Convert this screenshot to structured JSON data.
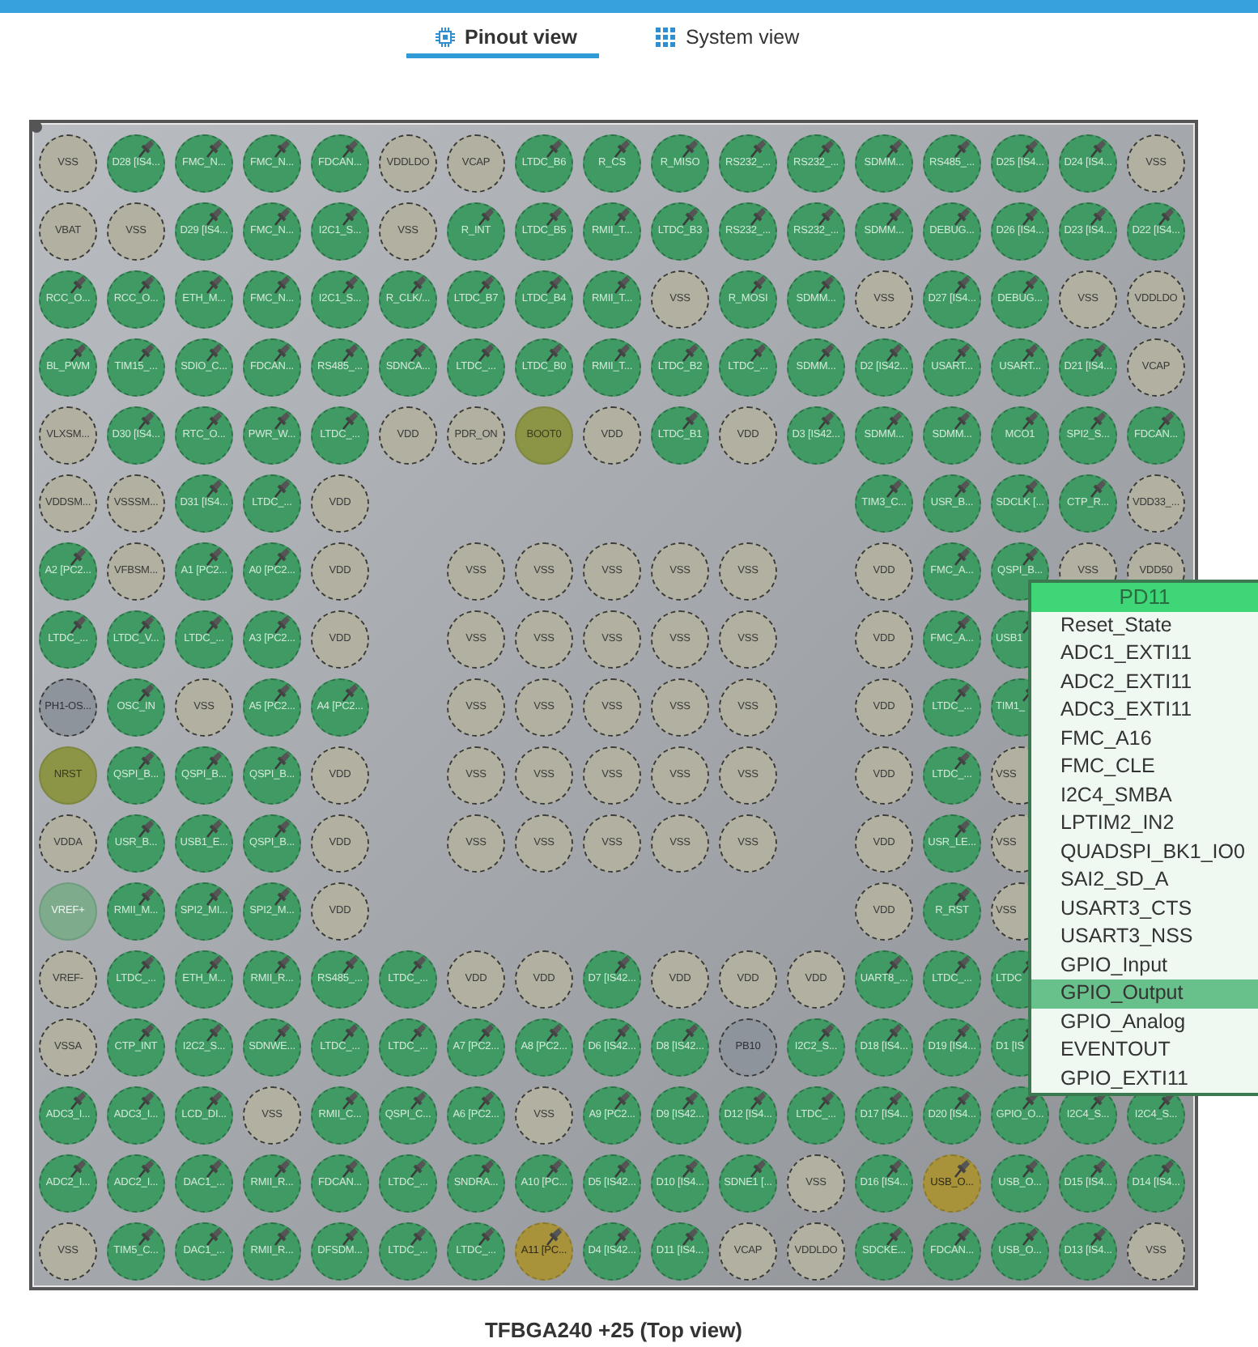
{
  "tabs": [
    {
      "label": "Pinout view",
      "selected": true,
      "kind": "pinout"
    },
    {
      "label": "System view",
      "selected": false,
      "kind": "system"
    }
  ],
  "package": {
    "caption": "TFBGA240 +25 (Top view)",
    "rows": [
      [
        {
          "label": "VSS",
          "kind": "power"
        },
        {
          "label": "D28 [IS4...",
          "kind": "signal"
        },
        {
          "label": "FMC_N...",
          "kind": "signal"
        },
        {
          "label": "FMC_N...",
          "kind": "signal"
        },
        {
          "label": "FDCAN...",
          "kind": "signal"
        },
        {
          "label": "VDDLDO",
          "kind": "power"
        },
        {
          "label": "VCAP",
          "kind": "power"
        },
        {
          "label": "LTDC_B6",
          "kind": "signal"
        },
        {
          "label": "R_CS",
          "kind": "signal"
        },
        {
          "label": "R_MISO",
          "kind": "signal"
        },
        {
          "label": "RS232_...",
          "kind": "signal"
        },
        {
          "label": "RS232_...",
          "kind": "signal"
        },
        {
          "label": "SDMM...",
          "kind": "signal"
        },
        {
          "label": "RS485_...",
          "kind": "signal"
        },
        {
          "label": "D25 [IS4...",
          "kind": "signal"
        },
        {
          "label": "D24 [IS4...",
          "kind": "signal"
        },
        {
          "label": "VSS",
          "kind": "power"
        }
      ],
      [
        {
          "label": "VBAT",
          "kind": "power"
        },
        {
          "label": "VSS",
          "kind": "power"
        },
        {
          "label": "D29 [IS4...",
          "kind": "signal"
        },
        {
          "label": "FMC_N...",
          "kind": "signal"
        },
        {
          "label": "I2C1_S...",
          "kind": "signal"
        },
        {
          "label": "VSS",
          "kind": "power"
        },
        {
          "label": "R_INT",
          "kind": "signal"
        },
        {
          "label": "LTDC_B5",
          "kind": "signal"
        },
        {
          "label": "RMII_T...",
          "kind": "signal"
        },
        {
          "label": "LTDC_B3",
          "kind": "signal"
        },
        {
          "label": "RS232_...",
          "kind": "signal"
        },
        {
          "label": "RS232_...",
          "kind": "signal"
        },
        {
          "label": "SDMM...",
          "kind": "signal"
        },
        {
          "label": "DEBUG...",
          "kind": "signal"
        },
        {
          "label": "D26 [IS4...",
          "kind": "signal"
        },
        {
          "label": "D23 [IS4...",
          "kind": "signal"
        },
        {
          "label": "D22 [IS4...",
          "kind": "signal"
        }
      ],
      [
        {
          "label": "RCC_O...",
          "kind": "signal"
        },
        {
          "label": "RCC_O...",
          "kind": "signal"
        },
        {
          "label": "ETH_M...",
          "kind": "signal"
        },
        {
          "label": "FMC_N...",
          "kind": "signal"
        },
        {
          "label": "I2C1_S...",
          "kind": "signal"
        },
        {
          "label": "R_CLK/...",
          "kind": "signal"
        },
        {
          "label": "LTDC_B7",
          "kind": "signal"
        },
        {
          "label": "LTDC_B4",
          "kind": "signal"
        },
        {
          "label": "RMII_T...",
          "kind": "signal"
        },
        {
          "label": "VSS",
          "kind": "power"
        },
        {
          "label": "R_MOSI",
          "kind": "signal"
        },
        {
          "label": "SDMM...",
          "kind": "signal"
        },
        {
          "label": "VSS",
          "kind": "power"
        },
        {
          "label": "D27 [IS4...",
          "kind": "signal"
        },
        {
          "label": "DEBUG...",
          "kind": "signal"
        },
        {
          "label": "VSS",
          "kind": "power"
        },
        {
          "label": "VDDLDO",
          "kind": "power"
        }
      ],
      [
        {
          "label": "BL_PWM",
          "kind": "signal"
        },
        {
          "label": "TIM15_...",
          "kind": "signal"
        },
        {
          "label": "SDIO_C...",
          "kind": "signal"
        },
        {
          "label": "FDCAN...",
          "kind": "signal"
        },
        {
          "label": "RS485_...",
          "kind": "signal"
        },
        {
          "label": "SDNCA...",
          "kind": "signal"
        },
        {
          "label": "LTDC_...",
          "kind": "signal"
        },
        {
          "label": "LTDC_B0",
          "kind": "signal"
        },
        {
          "label": "RMII_T...",
          "kind": "signal"
        },
        {
          "label": "LTDC_B2",
          "kind": "signal"
        },
        {
          "label": "LTDC_...",
          "kind": "signal"
        },
        {
          "label": "SDMM...",
          "kind": "signal"
        },
        {
          "label": "D2 [IS42...",
          "kind": "signal"
        },
        {
          "label": "USART...",
          "kind": "signal"
        },
        {
          "label": "USART...",
          "kind": "signal"
        },
        {
          "label": "D21 [IS4...",
          "kind": "signal"
        },
        {
          "label": "VCAP",
          "kind": "power"
        }
      ],
      [
        {
          "label": "VLXSM...",
          "kind": "power"
        },
        {
          "label": "D30 [IS4...",
          "kind": "signal"
        },
        {
          "label": "RTC_O...",
          "kind": "signal"
        },
        {
          "label": "PWR_W...",
          "kind": "signal"
        },
        {
          "label": "LTDC_...",
          "kind": "signal"
        },
        {
          "label": "VDD",
          "kind": "power"
        },
        {
          "label": "PDR_ON",
          "kind": "power"
        },
        {
          "label": "BOOT0",
          "kind": "reset"
        },
        {
          "label": "VDD",
          "kind": "power"
        },
        {
          "label": "LTDC_B1",
          "kind": "signal"
        },
        {
          "label": "VDD",
          "kind": "power"
        },
        {
          "label": "D3 [IS42...",
          "kind": "signal"
        },
        {
          "label": "SDMM...",
          "kind": "signal"
        },
        {
          "label": "SDMM...",
          "kind": "signal"
        },
        {
          "label": "MCO1",
          "kind": "signal"
        },
        {
          "label": "SPI2_S...",
          "kind": "signal"
        },
        {
          "label": "FDCAN...",
          "kind": "signal"
        }
      ],
      [
        {
          "label": "VDDSM...",
          "kind": "power"
        },
        {
          "label": "VSSSM...",
          "kind": "power"
        },
        {
          "label": "D31 [IS4...",
          "kind": "signal"
        },
        {
          "label": "LTDC_...",
          "kind": "signal"
        },
        {
          "label": "VDD",
          "kind": "power"
        },
        null,
        null,
        null,
        null,
        null,
        null,
        null,
        {
          "label": "TIM3_C...",
          "kind": "signal"
        },
        {
          "label": "USR_B...",
          "kind": "signal"
        },
        {
          "label": "SDCLK [...",
          "kind": "signal"
        },
        {
          "label": "CTP_R...",
          "kind": "signal"
        },
        {
          "label": "VDD33_...",
          "kind": "power"
        }
      ],
      [
        {
          "label": "A2 [PC2...",
          "kind": "signal"
        },
        {
          "label": "VFBSM...",
          "kind": "power"
        },
        {
          "label": "A1 [PC2...",
          "kind": "signal"
        },
        {
          "label": "A0 [PC2...",
          "kind": "signal"
        },
        {
          "label": "VDD",
          "kind": "power"
        },
        null,
        {
          "label": "VSS",
          "kind": "power"
        },
        {
          "label": "VSS",
          "kind": "power"
        },
        {
          "label": "VSS",
          "kind": "power"
        },
        {
          "label": "VSS",
          "kind": "power"
        },
        {
          "label": "VSS",
          "kind": "power"
        },
        null,
        {
          "label": "VDD",
          "kind": "power"
        },
        {
          "label": "FMC_A...",
          "kind": "signal"
        },
        {
          "label": "QSPI_B...",
          "kind": "signal"
        },
        {
          "label": "VSS",
          "kind": "power"
        },
        {
          "label": "VDD50",
          "kind": "power"
        }
      ],
      [
        {
          "label": "LTDC_...",
          "kind": "signal"
        },
        {
          "label": "LTDC_V...",
          "kind": "signal"
        },
        {
          "label": "LTDC_...",
          "kind": "signal"
        },
        {
          "label": "A3 [PC2...",
          "kind": "signal"
        },
        {
          "label": "VDD",
          "kind": "power"
        },
        null,
        {
          "label": "VSS",
          "kind": "power"
        },
        {
          "label": "VSS",
          "kind": "power"
        },
        {
          "label": "VSS",
          "kind": "power"
        },
        {
          "label": "VSS",
          "kind": "power"
        },
        {
          "label": "VSS",
          "kind": "power"
        },
        null,
        {
          "label": "VDD",
          "kind": "power"
        },
        {
          "label": "FMC_A...",
          "kind": "signal"
        },
        {
          "label": "USB1",
          "kind": "signal-cut"
        },
        null,
        null
      ],
      [
        {
          "label": "PH1-OS...",
          "kind": "osc"
        },
        {
          "label": "OSC_IN",
          "kind": "signal"
        },
        {
          "label": "VSS",
          "kind": "power"
        },
        {
          "label": "A5 [PC2...",
          "kind": "signal"
        },
        {
          "label": "A4 [PC2...",
          "kind": "signal"
        },
        null,
        {
          "label": "VSS",
          "kind": "power"
        },
        {
          "label": "VSS",
          "kind": "power"
        },
        {
          "label": "VSS",
          "kind": "power"
        },
        {
          "label": "VSS",
          "kind": "power"
        },
        {
          "label": "VSS",
          "kind": "power"
        },
        null,
        {
          "label": "VDD",
          "kind": "power"
        },
        {
          "label": "LTDC_...",
          "kind": "signal"
        },
        {
          "label": "TIM1_",
          "kind": "signal-cut"
        },
        null,
        null
      ],
      [
        {
          "label": "NRST",
          "kind": "reset"
        },
        {
          "label": "QSPI_B...",
          "kind": "signal"
        },
        {
          "label": "QSPI_B...",
          "kind": "signal"
        },
        {
          "label": "QSPI_B...",
          "kind": "signal"
        },
        {
          "label": "VDD",
          "kind": "power"
        },
        null,
        {
          "label": "VSS",
          "kind": "power"
        },
        {
          "label": "VSS",
          "kind": "power"
        },
        {
          "label": "VSS",
          "kind": "power"
        },
        {
          "label": "VSS",
          "kind": "power"
        },
        {
          "label": "VSS",
          "kind": "power"
        },
        null,
        {
          "label": "VDD",
          "kind": "power"
        },
        {
          "label": "LTDC_...",
          "kind": "signal"
        },
        {
          "label": "VSS",
          "kind": "power-cut"
        },
        null,
        null
      ],
      [
        {
          "label": "VDDA",
          "kind": "power"
        },
        {
          "label": "USR_B...",
          "kind": "signal"
        },
        {
          "label": "USB1_E...",
          "kind": "signal"
        },
        {
          "label": "QSPI_B...",
          "kind": "signal"
        },
        {
          "label": "VDD",
          "kind": "power"
        },
        null,
        {
          "label": "VSS",
          "kind": "power"
        },
        {
          "label": "VSS",
          "kind": "power"
        },
        {
          "label": "VSS",
          "kind": "power"
        },
        {
          "label": "VSS",
          "kind": "power"
        },
        {
          "label": "VSS",
          "kind": "power"
        },
        null,
        {
          "label": "VDD",
          "kind": "power"
        },
        {
          "label": "USR_LE...",
          "kind": "signal"
        },
        {
          "label": "VSS",
          "kind": "power-cut"
        },
        null,
        null
      ],
      [
        {
          "label": "VREF+",
          "kind": "analog"
        },
        {
          "label": "RMII_M...",
          "kind": "signal"
        },
        {
          "label": "SPI2_MI...",
          "kind": "signal"
        },
        {
          "label": "SPI2_M...",
          "kind": "signal"
        },
        {
          "label": "VDD",
          "kind": "power"
        },
        null,
        null,
        null,
        null,
        null,
        null,
        null,
        {
          "label": "VDD",
          "kind": "power"
        },
        {
          "label": "R_RST",
          "kind": "signal"
        },
        {
          "label": "VSS",
          "kind": "power-cut"
        },
        null,
        null
      ],
      [
        {
          "label": "VREF-",
          "kind": "power"
        },
        {
          "label": "LTDC_...",
          "kind": "signal"
        },
        {
          "label": "ETH_M...",
          "kind": "signal"
        },
        {
          "label": "RMII_R...",
          "kind": "signal"
        },
        {
          "label": "RS485_...",
          "kind": "signal"
        },
        {
          "label": "LTDC_...",
          "kind": "signal"
        },
        {
          "label": "VDD",
          "kind": "power"
        },
        {
          "label": "VDD",
          "kind": "power"
        },
        {
          "label": "D7 [IS42...",
          "kind": "signal"
        },
        {
          "label": "VDD",
          "kind": "power"
        },
        {
          "label": "VDD",
          "kind": "power"
        },
        {
          "label": "VDD",
          "kind": "power"
        },
        {
          "label": "UART8_...",
          "kind": "signal"
        },
        {
          "label": "LTDC_...",
          "kind": "signal"
        },
        {
          "label": "LTDC",
          "kind": "signal-cut"
        },
        null,
        null
      ],
      [
        {
          "label": "VSSA",
          "kind": "power"
        },
        {
          "label": "CTP_INT",
          "kind": "signal"
        },
        {
          "label": "I2C2_S...",
          "kind": "signal"
        },
        {
          "label": "SDNWE...",
          "kind": "signal"
        },
        {
          "label": "LTDC_...",
          "kind": "signal"
        },
        {
          "label": "LTDC_...",
          "kind": "signal"
        },
        {
          "label": "A7 [PC2...",
          "kind": "signal"
        },
        {
          "label": "A8 [PC2...",
          "kind": "signal"
        },
        {
          "label": "D6 [IS42...",
          "kind": "signal"
        },
        {
          "label": "D8 [IS42...",
          "kind": "signal"
        },
        {
          "label": "PB10",
          "kind": "osc"
        },
        {
          "label": "I2C2_S...",
          "kind": "signal"
        },
        {
          "label": "D18 [IS4...",
          "kind": "signal"
        },
        {
          "label": "D19 [IS4...",
          "kind": "signal"
        },
        {
          "label": "D1 [IS",
          "kind": "signal-cut"
        },
        null,
        null
      ],
      [
        {
          "label": "ADC3_I...",
          "kind": "signal"
        },
        {
          "label": "ADC3_I...",
          "kind": "signal"
        },
        {
          "label": "LCD_DI...",
          "kind": "signal"
        },
        {
          "label": "VSS",
          "kind": "power"
        },
        {
          "label": "RMII_C...",
          "kind": "signal"
        },
        {
          "label": "QSPI_C...",
          "kind": "signal"
        },
        {
          "label": "A6 [PC2...",
          "kind": "signal"
        },
        {
          "label": "VSS",
          "kind": "power"
        },
        {
          "label": "A9 [PC2...",
          "kind": "signal"
        },
        {
          "label": "D9 [IS42...",
          "kind": "signal"
        },
        {
          "label": "D12 [IS4...",
          "kind": "signal"
        },
        {
          "label": "LTDC_...",
          "kind": "signal"
        },
        {
          "label": "D17 [IS4...",
          "kind": "signal"
        },
        {
          "label": "D20 [IS4...",
          "kind": "signal"
        },
        {
          "label": "GPIO_O...",
          "kind": "signal"
        },
        {
          "label": "I2C4_S...",
          "kind": "signal"
        },
        {
          "label": "I2C4_S...",
          "kind": "signal"
        }
      ],
      [
        {
          "label": "ADC2_I...",
          "kind": "signal"
        },
        {
          "label": "ADC2_I...",
          "kind": "signal"
        },
        {
          "label": "DAC1_...",
          "kind": "signal"
        },
        {
          "label": "RMII_R...",
          "kind": "signal"
        },
        {
          "label": "FDCAN...",
          "kind": "signal"
        },
        {
          "label": "LTDC_...",
          "kind": "signal"
        },
        {
          "label": "SNDRA...",
          "kind": "signal"
        },
        {
          "label": "A10 [PC...",
          "kind": "signal"
        },
        {
          "label": "D5 [IS42...",
          "kind": "signal"
        },
        {
          "label": "D10 [IS4...",
          "kind": "signal"
        },
        {
          "label": "SDNE1 [...",
          "kind": "signal"
        },
        {
          "label": "VSS",
          "kind": "power"
        },
        {
          "label": "D16 [IS4...",
          "kind": "signal"
        },
        {
          "label": "USB_O...",
          "kind": "alert"
        },
        {
          "label": "USB_O...",
          "kind": "signal"
        },
        {
          "label": "D15 [IS4...",
          "kind": "signal"
        },
        {
          "label": "D14 [IS4...",
          "kind": "signal"
        }
      ],
      [
        {
          "label": "VSS",
          "kind": "power"
        },
        {
          "label": "TIM5_C...",
          "kind": "signal"
        },
        {
          "label": "DAC1_...",
          "kind": "signal"
        },
        {
          "label": "RMII_R...",
          "kind": "signal"
        },
        {
          "label": "DFSDM...",
          "kind": "signal"
        },
        {
          "label": "LTDC_...",
          "kind": "signal"
        },
        {
          "label": "LTDC_...",
          "kind": "signal"
        },
        {
          "label": "A11 [PC...",
          "kind": "alert"
        },
        {
          "label": "D4 [IS42...",
          "kind": "signal"
        },
        {
          "label": "D11 [IS4...",
          "kind": "signal"
        },
        {
          "label": "VCAP",
          "kind": "power"
        },
        {
          "label": "VDDLDO",
          "kind": "power"
        },
        {
          "label": "SDCKE...",
          "kind": "signal"
        },
        {
          "label": "FDCAN...",
          "kind": "signal"
        },
        {
          "label": "USB_O...",
          "kind": "signal"
        },
        {
          "label": "D13 [IS4...",
          "kind": "signal"
        },
        {
          "label": "VSS",
          "kind": "power"
        }
      ]
    ]
  },
  "pin_menu": {
    "title": "PD11",
    "items": [
      {
        "label": "Reset_State",
        "selected": false
      },
      {
        "label": "ADC1_EXTI11",
        "selected": false
      },
      {
        "label": "ADC2_EXTI11",
        "selected": false
      },
      {
        "label": "ADC3_EXTI11",
        "selected": false
      },
      {
        "label": "FMC_A16",
        "selected": false
      },
      {
        "label": "FMC_CLE",
        "selected": false
      },
      {
        "label": "I2C4_SMBA",
        "selected": false
      },
      {
        "label": "LPTIM2_IN2",
        "selected": false
      },
      {
        "label": "QUADSPI_BK1_IO0",
        "selected": false
      },
      {
        "label": "SAI2_SD_A",
        "selected": false
      },
      {
        "label": "USART3_CTS",
        "selected": false
      },
      {
        "label": "USART3_NSS",
        "selected": false
      },
      {
        "label": "GPIO_Input",
        "selected": false
      },
      {
        "label": "GPIO_Output",
        "selected": true
      },
      {
        "label": "GPIO_Analog",
        "selected": false
      },
      {
        "label": "EVENTOUT",
        "selected": false
      },
      {
        "label": "GPIO_EXTI11",
        "selected": false
      }
    ]
  }
}
